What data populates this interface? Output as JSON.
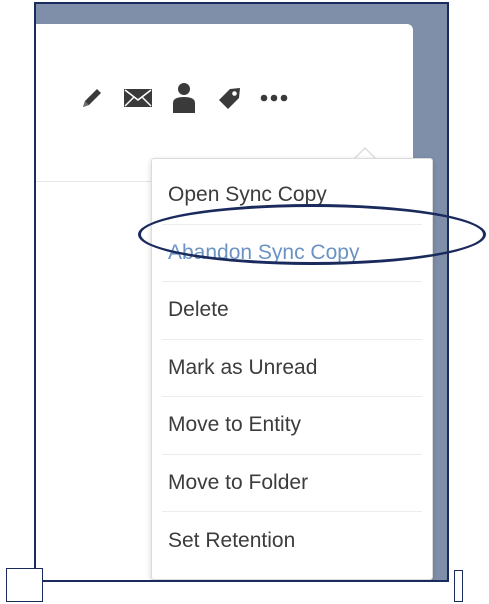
{
  "toolbar": {
    "icons": [
      "pencil-icon",
      "envelope-icon",
      "person-icon",
      "tag-icon",
      "more-icon"
    ],
    "icon_color": "#3a3a3a"
  },
  "menu": {
    "items": [
      {
        "label": "Open Sync Copy"
      },
      {
        "label": "Abandon Sync Copy",
        "highlighted": true
      },
      {
        "label": "Delete"
      },
      {
        "label": "Mark as Unread"
      },
      {
        "label": "Move to Entity"
      },
      {
        "label": "Move to Folder"
      },
      {
        "label": "Set Retention"
      }
    ],
    "highlight_color": "#6a93c4",
    "text_color": "#3c3c3c"
  },
  "annotation": {
    "color": "#1a2a5c"
  },
  "background_color": "#7f8faa"
}
